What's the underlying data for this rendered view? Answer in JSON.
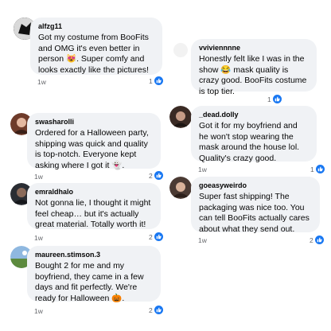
{
  "comments": [
    {
      "username": "alfzg11",
      "text": "Got my costume from BooFits and OMG it's even better in person 😻. Super comfy and looks exactly like the pictures!",
      "time": "1w",
      "likes": "1"
    },
    {
      "username": "vviviennnne",
      "text": "Honestly felt like I was in the show 😂 mask quality is crazy good. BooFits costume is top tier.",
      "time": "",
      "likes": "1"
    },
    {
      "username": "swasharolli",
      "text": "Ordered for a Halloween party, shipping was quick and quality is top-notch. Everyone kept asking where I got it 👻.",
      "time": "1w",
      "likes": "2"
    },
    {
      "username": "_dead.dolly",
      "text": "Got it for my boyfriend and he won't stop wearing the mask around the house lol. Quality's crazy good.",
      "time": "1w",
      "likes": "1"
    },
    {
      "username": "emraldhalo",
      "text": "Not gonna lie, I thought it might feel cheap… but it's actually great material. Totally worth it!",
      "time": "1w",
      "likes": "2"
    },
    {
      "username": "goeasyweirdo",
      "text": "Super fast shipping! The packaging was nice too. You can tell BooFits actually cares about what they send out.",
      "time": "1w",
      "likes": "2"
    },
    {
      "username": "maureen.stimson.3",
      "text": "Bought 2 for me and my boyfriend, they came in a few days and fit perfectly. We're ready for Halloween 🎃.",
      "time": "1w",
      "likes": "2"
    }
  ],
  "colors": {
    "bubble": "#f0f2f5",
    "like": "#1877f2",
    "meta": "#65676b"
  },
  "icons": {
    "like": "thumbs-up-icon"
  }
}
